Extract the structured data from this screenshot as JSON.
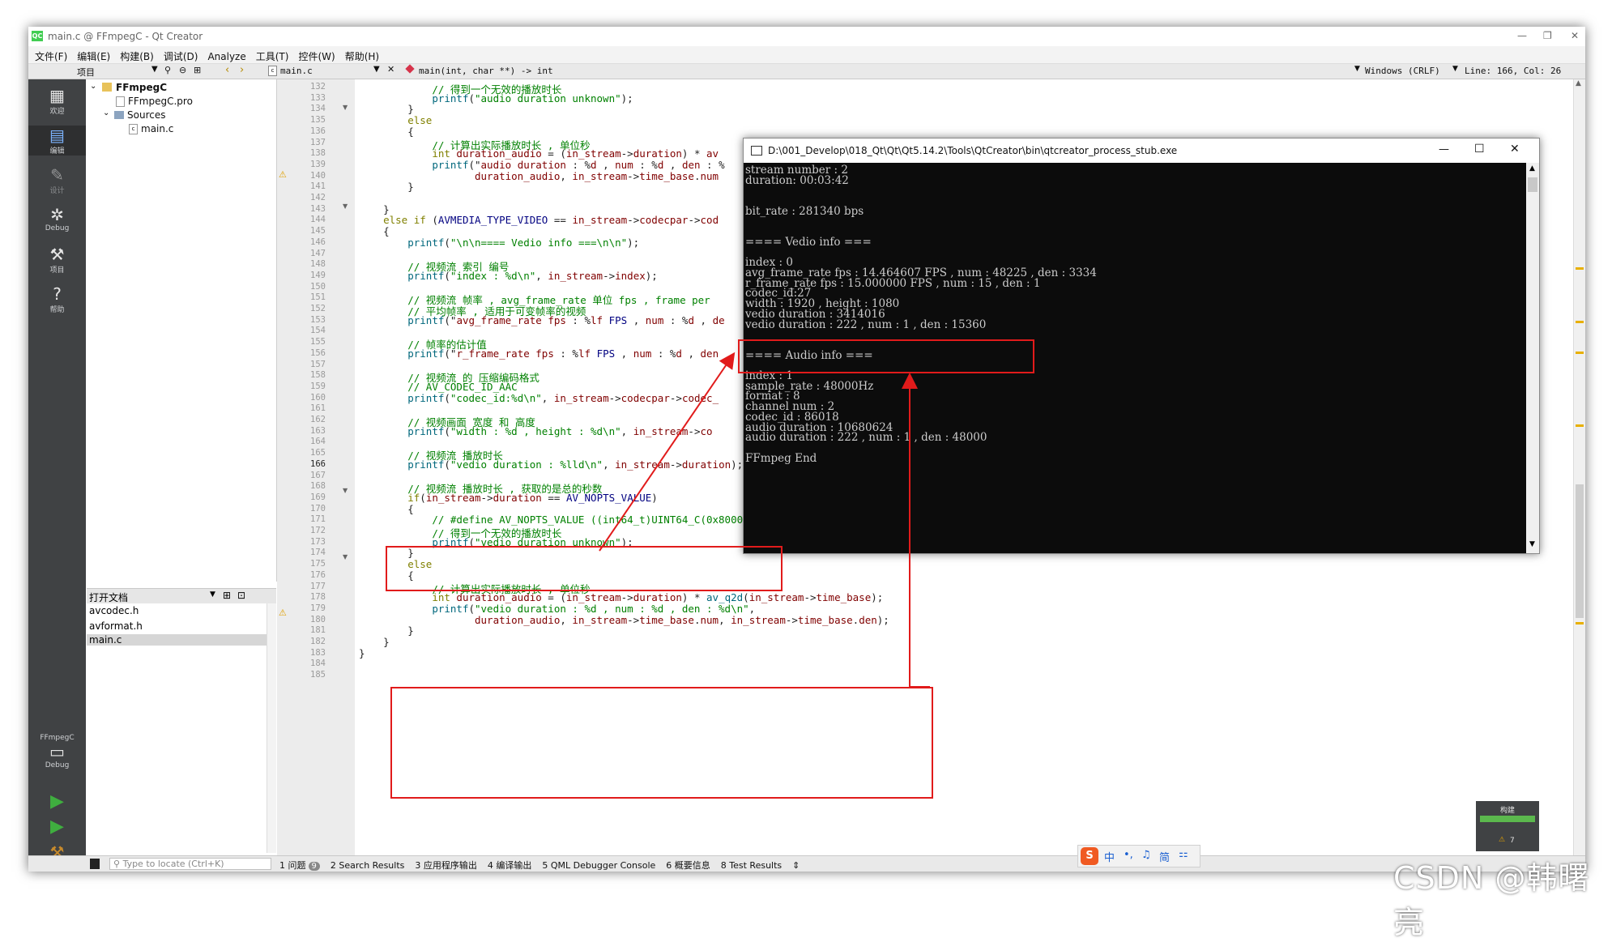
{
  "window": {
    "title": "main.c @ FFmpegC - Qt Creator",
    "controls": [
      "—",
      "❐",
      "✕"
    ]
  },
  "menu": [
    "文件(F)",
    "编辑(E)",
    "构建(B)",
    "调试(D)",
    "Analyze",
    "工具(T)",
    "控件(W)",
    "帮助(H)"
  ],
  "toolbar": {
    "project_label": "项目",
    "file_tab": "main.c",
    "function": "main(int, char **) -> int",
    "line_ending": "Windows (CRLF)",
    "position": "Line: 166, Col: 26"
  },
  "modes": [
    "欢迎",
    "编辑",
    "设计",
    "Debug",
    "项目",
    "帮助"
  ],
  "kit": {
    "project": "FFmpegC",
    "build": "Debug"
  },
  "project_tree": {
    "root": "FFmpegC",
    "pro_file": "FFmpegC.pro",
    "sources": "Sources",
    "main": "main.c"
  },
  "open_docs": {
    "title": "打开文档",
    "files": [
      "avcodec.h",
      "avformat.h",
      "main.c"
    ]
  },
  "code": {
    "line_numbers": [
      "132",
      "133",
      "134",
      "135",
      "136",
      "137",
      "138",
      "139",
      "140",
      "141",
      "142",
      "143",
      "144",
      "145",
      "146",
      "147",
      "148",
      "149",
      "150",
      "151",
      "152",
      "153",
      "154",
      "155",
      "156",
      "157",
      "158",
      "159",
      "160",
      "161",
      "162",
      "163",
      "164",
      "165",
      "166",
      "167",
      "168",
      "169",
      "170",
      "171",
      "172",
      "173",
      "174",
      "175",
      "176",
      "177",
      "178",
      "179",
      "180",
      "181",
      "182",
      "183",
      "184",
      "185"
    ],
    "lines": [
      "            // 得到一个无效的播放时长",
      "            printf(\"audio duration unknown\");",
      "        }",
      "        else",
      "        {",
      "            // 计算出实际播放时长 , 单位秒",
      "            int duration_audio = (in_stream->duration) * av",
      "            printf(\"audio duration : %d , num : %d , den : %",
      "                   duration_audio, in_stream->time_base.num",
      "        }",
      "",
      "    }",
      "    else if (AVMEDIA_TYPE_VIDEO == in_stream->codecpar->cod",
      "    {",
      "        printf(\"\\n\\n==== Vedio info ===\\n\\n\");",
      "",
      "        // 视频流 索引 编号",
      "        printf(\"index : %d\\n\", in_stream->index);",
      "",
      "        // 视频流 帧率 , avg_frame_rate 单位 fps , frame per",
      "        // 平均帧率 , 适用于可变帧率的视频",
      "        printf(\"avg_frame_rate fps : %lf FPS , num : %d , de",
      "",
      "        // 帧率的估计值",
      "        printf(\"r_frame_rate fps : %lf FPS , num : %d , den",
      "",
      "        // 视频流 的 压缩编码格式",
      "        // AV_CODEC_ID_AAC",
      "        printf(\"codec_id:%d\\n\", in_stream->codecpar->codec_",
      "",
      "        // 视频画面 宽度 和 高度",
      "        printf(\"width : %d , height : %d\\n\", in_stream->co",
      "",
      "        // 视频流 播放时长",
      "        printf(\"vedio duration : %lld\\n\", in_stream->duration);",
      "",
      "        // 视频流 播放时长 , 获取的是总的秒数",
      "        if(in_stream->duration == AV_NOPTS_VALUE)",
      "        {",
      "            // #define AV_NOPTS_VALUE ((int64_t)UINT64_C(0x8000000000000000))",
      "            // 得到一个无效的播放时长",
      "            printf(\"vedio duration unknown\");",
      "        }",
      "        else",
      "        {",
      "            // 计算出实际播放时长 , 单位秒",
      "            int duration_audio = (in_stream->duration) * av_q2d(in_stream->time_base);",
      "            printf(\"vedio duration : %d , num : %d , den : %d\\n\",",
      "                   duration_audio, in_stream->time_base.num, in_stream->time_base.den);",
      "        }",
      "    }",
      "}",
      "",
      ""
    ]
  },
  "console": {
    "title": "D:\\001_Develop\\018_Qt\\Qt\\Qt5.14.2\\Tools\\QtCreator\\bin\\qtcreator_process_stub.exe",
    "lines": [
      "stream number : 2",
      "duration: 00:03:42",
      "",
      "",
      "bit_rate : 281340 bps",
      "",
      "",
      "==== Vedio info ===",
      "",
      "index : 0",
      "avg_frame_rate fps : 14.464607 FPS , num : 48225 , den : 3334",
      "r_frame_rate fps : 15.000000 FPS , num : 15 , den : 1",
      "codec_id:27",
      "width : 1920 , height : 1080",
      "vedio duration : 3414016",
      "vedio duration : 222 , num : 1 , den : 15360",
      "",
      "",
      "==== Audio info ===",
      "",
      "index : 1",
      "sample_rate : 48000Hz",
      "format : 8",
      "channel num : 2",
      "codec_id : 86018",
      "audio duration : 10680624",
      "audio duration : 222 , num : 1 , den : 48000",
      "",
      "FFmpeg End"
    ]
  },
  "status": {
    "locate_placeholder": "Type to locate (Ctrl+K)",
    "tabs": [
      "1 问题",
      "2 Search Results",
      "3 应用程序输出",
      "4 编译输出",
      "5 QML Debugger Console",
      "6 概要信息",
      "8 Test Results"
    ],
    "issues_count": "9"
  },
  "build_panel": {
    "title": "构建",
    "warnings": "7"
  },
  "ime": {
    "labels": [
      "中",
      "•,",
      "♫",
      "简",
      "⚏"
    ]
  },
  "watermark": "CSDN @韩曙亮",
  "colors": {
    "keyword": "#808000",
    "string": "#008000",
    "comment": "#008000",
    "type": "#000080",
    "highlight": "#e11b1b"
  }
}
